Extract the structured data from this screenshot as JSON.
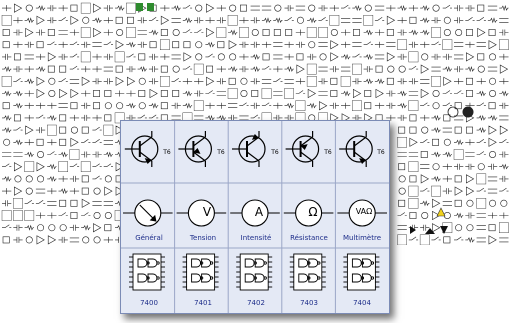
{
  "symbol_library": {
    "rows": [
      {
        "name": "transistors",
        "items": [
          {
            "icon": "npn-transistor-icon",
            "label": "",
            "tag": "T6"
          },
          {
            "icon": "pnp-transistor-icon",
            "label": "",
            "tag": "T6"
          },
          {
            "icon": "npn-transistor-emitter-down-icon",
            "label": "",
            "tag": "T6"
          },
          {
            "icon": "pnp-transistor-emitter-down-icon",
            "label": "",
            "tag": "T6"
          },
          {
            "icon": "npn-transistor-alt-icon",
            "label": "",
            "tag": "T6"
          }
        ]
      },
      {
        "name": "meters",
        "items": [
          {
            "icon": "general-meter-icon",
            "label": "Général",
            "glyph": ""
          },
          {
            "icon": "voltmeter-icon",
            "label": "Tension",
            "glyph": "V"
          },
          {
            "icon": "ammeter-icon",
            "label": "Intensité",
            "glyph": "A"
          },
          {
            "icon": "ohmmeter-icon",
            "label": "Résistance",
            "glyph": "Ω"
          },
          {
            "icon": "multimeter-icon",
            "label": "Multimètre",
            "glyph": "VAΩ"
          }
        ]
      },
      {
        "name": "logic-ics",
        "items": [
          {
            "icon": "ic-7400-icon",
            "label": "7400"
          },
          {
            "icon": "ic-7401-icon",
            "label": "7401"
          },
          {
            "icon": "ic-7402-icon",
            "label": "7402"
          },
          {
            "icon": "ic-7403-icon",
            "label": "7403"
          },
          {
            "icon": "ic-7404-icon",
            "label": "7404"
          }
        ]
      }
    ]
  },
  "colors": {
    "panel_bg": "#e4e9f5",
    "grid_line": "#9aa6c7",
    "label_text": "#1e2e8a",
    "symbol_stroke": "#000000",
    "warning_yellow": "#f2d21b",
    "accent_green": "#2e8b2e"
  }
}
